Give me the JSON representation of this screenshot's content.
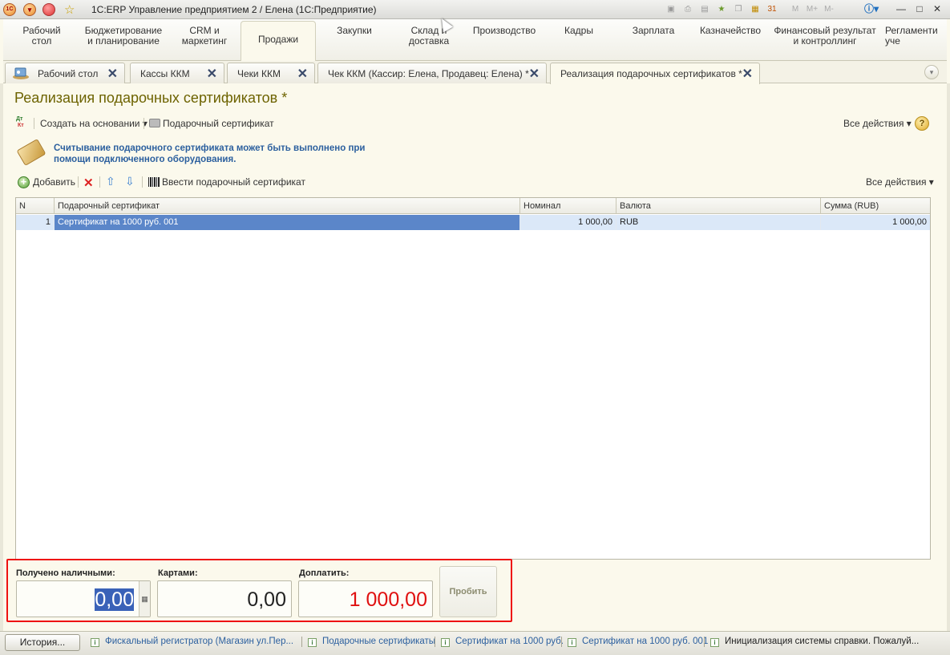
{
  "window": {
    "title": "1С:ERP Управление предприятием 2 / Елена  (1С:Предприятие)",
    "logo": "1C",
    "toolbar_icons": [
      "save-icon",
      "print-icon",
      "preview-icon",
      "favorites-add-icon",
      "copy-icon",
      "calculator-icon",
      "calendar-icon"
    ],
    "memory_buttons": [
      "M",
      "M+",
      "M-"
    ],
    "calendar_day": "31"
  },
  "sections": [
    {
      "label": "Рабочий\nстол",
      "active": false
    },
    {
      "label": "Бюджетирование\nи планирование",
      "active": false
    },
    {
      "label": "CRM и\nмаркетинг",
      "active": false
    },
    {
      "label": "Продажи",
      "active": true
    },
    {
      "label": "Закупки",
      "active": false
    },
    {
      "label": "Склад и\nдоставка",
      "active": false
    },
    {
      "label": "Производство",
      "active": false
    },
    {
      "label": "Кадры",
      "active": false
    },
    {
      "label": "Зарплата",
      "active": false
    },
    {
      "label": "Казначейство",
      "active": false
    },
    {
      "label": "Финансовый результат\nи контроллинг",
      "active": false
    },
    {
      "label": "Регламенти\nуче",
      "active": false
    }
  ],
  "open_tabs": [
    {
      "label": "Рабочий стол",
      "active": false
    },
    {
      "label": "Кассы ККМ",
      "active": false
    },
    {
      "label": "Чеки ККМ",
      "active": false
    },
    {
      "label": "Чек ККМ (Кассир: Елена, Продавец: Елена) *",
      "active": false
    },
    {
      "label": "Реализация подарочных сертификатов *",
      "active": true
    }
  ],
  "form": {
    "title": "Реализация подарочных сертификатов *",
    "toolbar": {
      "create_based_on": "Создать на основании",
      "gift_cert_print": "Подарочный сертификат",
      "all_actions": "Все действия",
      "help": "?"
    },
    "info": "Считывание подарочного сертификата может быть выполнено при помощи подключенного оборудования.",
    "table_toolbar": {
      "add": "Добавить",
      "enter_cert": "Ввести подарочный сертификат",
      "all_actions": "Все действия"
    },
    "table": {
      "columns": [
        "N",
        "Подарочный сертификат",
        "Номинал",
        "Валюта",
        "Сумма (RUB)"
      ],
      "rows": [
        [
          "1",
          "Сертификат на 1000 руб. 001",
          "1 000,00",
          "RUB",
          "1 000,00"
        ]
      ]
    },
    "payment": {
      "cash_label": "Получено наличными:",
      "cash_value": "0,00",
      "cards_label": "Картами:",
      "cards_value": "0,00",
      "due_label": "Доплатить:",
      "due_value": "1 000,00",
      "due_color": "#e01010",
      "punch_button": "Пробить"
    }
  },
  "statusbar": {
    "history_button": "История...",
    "items": [
      "Фискальный регистратор (Магазин ул.Пер...",
      "Подарочные сертификаты",
      "Сертификат на 1000 руб.",
      "Сертификат на 1000 руб. 001",
      "Инициализация системы справки. Пожалуй..."
    ]
  },
  "accent": "#6d6300"
}
